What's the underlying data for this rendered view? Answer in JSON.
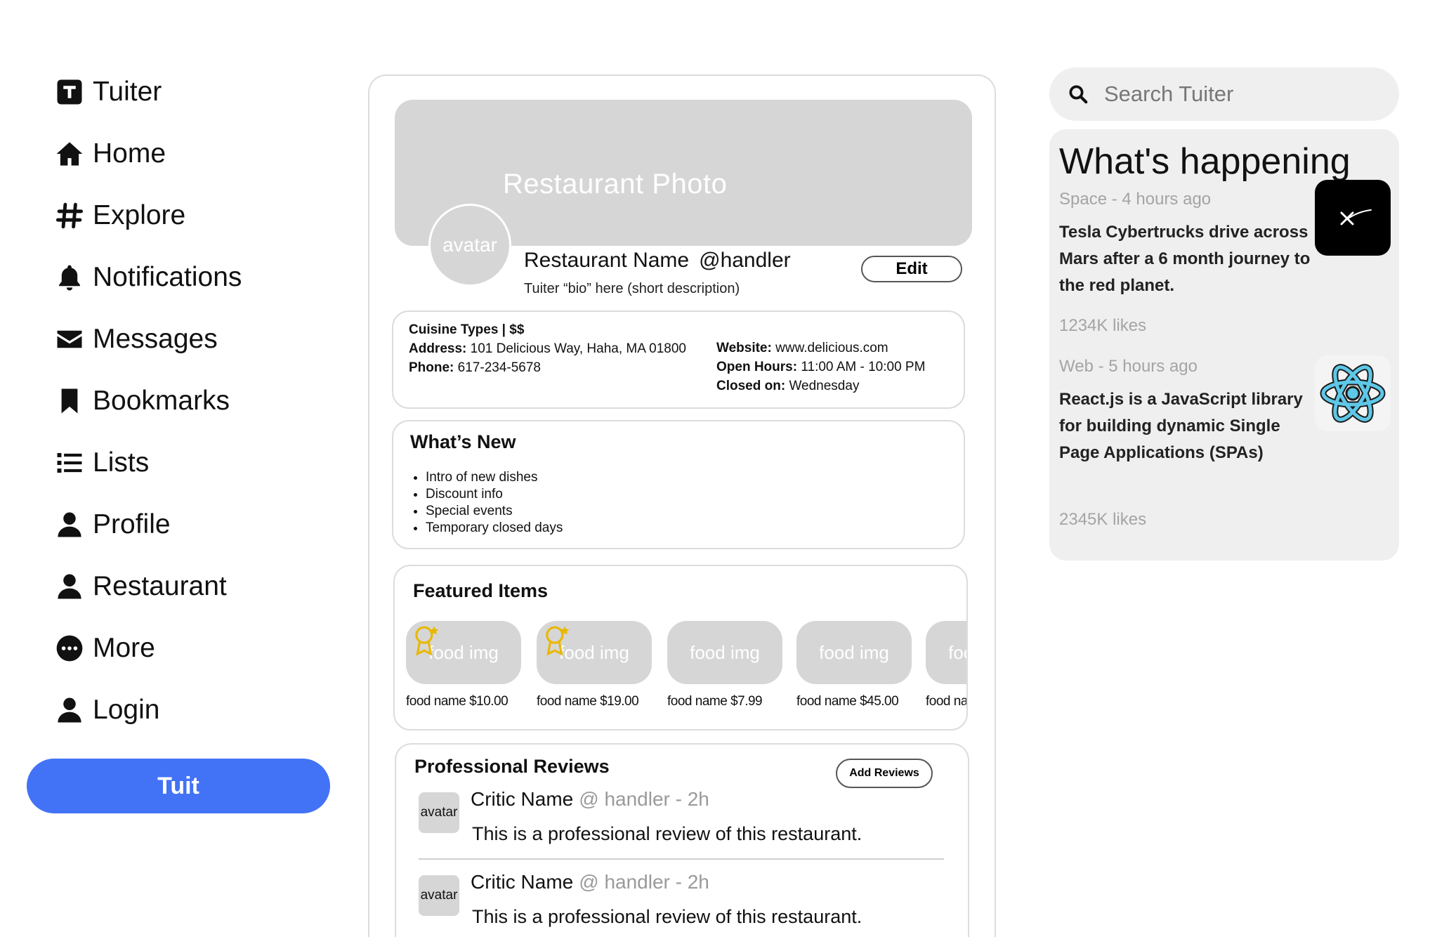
{
  "nav": {
    "brand": {
      "label": "Tuiter",
      "icon": "tuiter-logo-icon"
    },
    "items": [
      {
        "label": "Home",
        "icon": "home-icon"
      },
      {
        "label": "Explore",
        "icon": "hashtag-icon"
      },
      {
        "label": "Notifications",
        "icon": "bell-icon"
      },
      {
        "label": "Messages",
        "icon": "envelope-icon"
      },
      {
        "label": "Bookmarks",
        "icon": "bookmark-icon"
      },
      {
        "label": "Lists",
        "icon": "list-icon"
      },
      {
        "label": "Profile",
        "icon": "user-icon"
      },
      {
        "label": "Restaurant",
        "icon": "user-icon"
      },
      {
        "label": "More",
        "icon": "more-circle-icon"
      },
      {
        "label": "Login",
        "icon": "user-icon"
      }
    ],
    "tuit_button": "Tuit",
    "accent_color": "#4272f5"
  },
  "profile": {
    "banner_text": "Restaurant Photo",
    "avatar_text": "avatar",
    "name": "Restaurant Name",
    "handle": "@handler",
    "bio": "Tuiter “bio” here (short description)",
    "edit_button": "Edit"
  },
  "info": {
    "cuisine": "Cuisine Types | $$",
    "address_label": "Address:",
    "address_value": "101 Delicious Way, Haha, MA 01800",
    "phone_label": "Phone:",
    "phone_value": "617-234-5678",
    "website_label": "Website:",
    "website_value": "www.delicious.com",
    "hours_label": "Open Hours:",
    "hours_value": "11:00 AM - 10:00 PM",
    "closed_label": "Closed on:",
    "closed_value": "Wednesday"
  },
  "whats_new": {
    "title": "What’s New",
    "items": [
      "Intro of new dishes",
      "Discount info",
      "Special events",
      "Temporary closed days"
    ]
  },
  "featured": {
    "title": "Featured Items",
    "img_text": "food img",
    "items": [
      {
        "name": "food name $10.00",
        "badge": true
      },
      {
        "name": "food name $19.00",
        "badge": true
      },
      {
        "name": "food name $7.99",
        "badge": false
      },
      {
        "name": "food name $45.00",
        "badge": false
      },
      {
        "name": "food name",
        "badge": false
      }
    ]
  },
  "reviews": {
    "title": "Professional Reviews",
    "add_button": "Add Reviews",
    "items": [
      {
        "avatar": "avatar",
        "name": "Critic Name",
        "meta": "@ handler - 2h",
        "text": "This is a professional review of this restaurant."
      },
      {
        "avatar": "avatar",
        "name": "Critic Name",
        "meta": "@ handler - 2h",
        "text": "This is a professional review of this restaurant."
      }
    ]
  },
  "search": {
    "placeholder": "Search Tuiter"
  },
  "happening": {
    "title": "What's happening",
    "trends": [
      {
        "meta": "Space - 4 hours ago",
        "text": "Tesla Cybertrucks drive across Mars after a 6 month journey to the red planet.",
        "likes": "1234K likes",
        "thumb_icon": "spacex-logo-icon"
      },
      {
        "meta": "Web - 5 hours ago",
        "text": "React.js is a JavaScript library for building dynamic Single Page Applications (SPAs)",
        "likes": "2345K likes",
        "thumb_icon": "react-logo-icon"
      }
    ]
  }
}
